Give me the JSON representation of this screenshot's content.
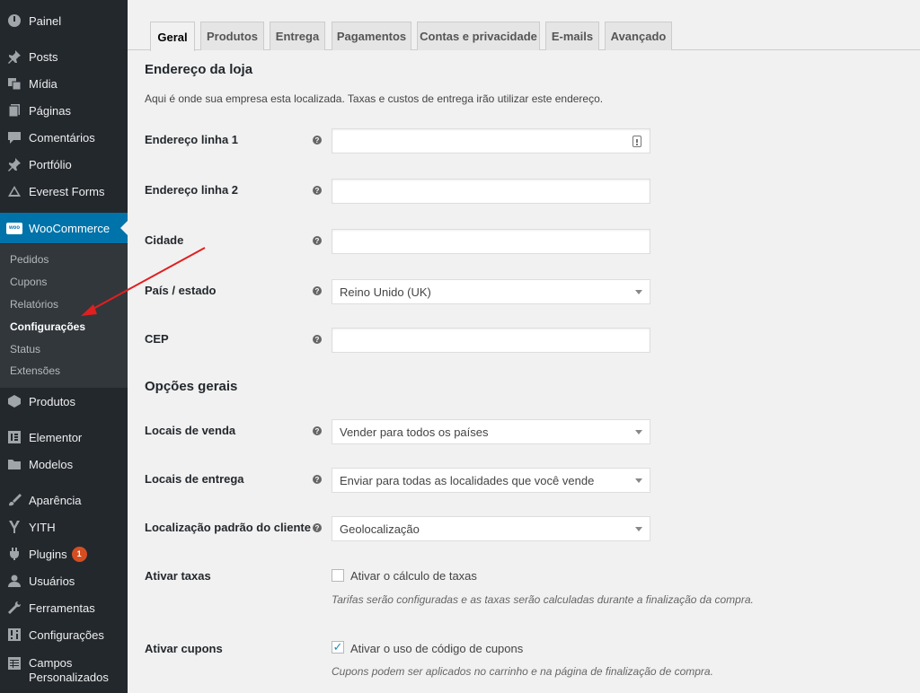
{
  "sidebar": {
    "items": [
      {
        "label": "Painel",
        "icon": "dashboard-icon"
      },
      {
        "label": "Posts",
        "icon": "pin-icon"
      },
      {
        "label": "Mídia",
        "icon": "media-icon"
      },
      {
        "label": "Páginas",
        "icon": "pages-icon"
      },
      {
        "label": "Comentários",
        "icon": "comments-icon"
      },
      {
        "label": "Portfólio",
        "icon": "pin-icon"
      },
      {
        "label": "Everest Forms",
        "icon": "everest-forms-icon"
      },
      {
        "label": "WooCommerce",
        "icon": "woocommerce-icon"
      },
      {
        "label": "Produtos",
        "icon": "products-icon"
      },
      {
        "label": "Elementor",
        "icon": "elementor-icon"
      },
      {
        "label": "Modelos",
        "icon": "folder-icon"
      },
      {
        "label": "Aparência",
        "icon": "appearance-icon"
      },
      {
        "label": "YITH",
        "icon": "yith-icon"
      },
      {
        "label": "Plugins",
        "icon": "plugins-icon",
        "badge": "1"
      },
      {
        "label": "Usuários",
        "icon": "users-icon"
      },
      {
        "label": "Ferramentas",
        "icon": "tools-icon"
      },
      {
        "label": "Configurações",
        "icon": "settings-icon"
      },
      {
        "label": "Campos Personalizados",
        "label_line1": "Campos",
        "label_line2": "Personalizados",
        "icon": "table-icon"
      }
    ],
    "woo_logo_text": "woo",
    "submenu": [
      {
        "label": "Pedidos"
      },
      {
        "label": "Cupons"
      },
      {
        "label": "Relatórios"
      },
      {
        "label": "Configurações",
        "active": true
      },
      {
        "label": "Status"
      },
      {
        "label": "Extensões"
      }
    ]
  },
  "tabs": [
    {
      "label": "Geral",
      "active": true
    },
    {
      "label": "Produtos"
    },
    {
      "label": "Entrega"
    },
    {
      "label": "Pagamentos"
    },
    {
      "label": "Contas e privacidade"
    },
    {
      "label": "E-mails"
    },
    {
      "label": "Avançado"
    }
  ],
  "store_address": {
    "title": "Endereço da loja",
    "description": "Aqui é onde sua empresa esta localizada. Taxas e custos de entrega irão utilizar este endereço.",
    "fields": {
      "address1": {
        "label": "Endereço linha 1",
        "value": ""
      },
      "address2": {
        "label": "Endereço linha 2",
        "value": ""
      },
      "city": {
        "label": "Cidade",
        "value": ""
      },
      "country": {
        "label": "País / estado",
        "value": "Reino Unido (UK)"
      },
      "postcode": {
        "label": "CEP",
        "value": ""
      }
    }
  },
  "general_options": {
    "title": "Opções gerais",
    "selling_locations": {
      "label": "Locais de venda",
      "value": "Vender para todos os países"
    },
    "shipping_locations": {
      "label": "Locais de entrega",
      "value": "Enviar para todas as localidades que você vende"
    },
    "default_customer_location": {
      "label": "Localização padrão do cliente",
      "value": "Geolocalização"
    },
    "enable_taxes": {
      "label": "Ativar taxas",
      "checkbox_label": "Ativar o cálculo de taxas",
      "checked": false,
      "description": "Tarifas serão configuradas e as taxas serão calculadas durante a finalização da compra."
    },
    "enable_coupons": {
      "label": "Ativar cupons",
      "checkbox_label": "Ativar o uso de código de cupons",
      "checked": true,
      "description": "Cupons podem ser aplicados no carrinho e na página de finalização de compra."
    }
  },
  "help_glyph": "?",
  "checkmark_glyph": "✓",
  "colors": {
    "sidebar_bg": "#23282d",
    "submenu_bg": "#32373c",
    "accent": "#0073aa",
    "annotation_arrow": "#e01f1f",
    "badge": "#d54e21"
  }
}
